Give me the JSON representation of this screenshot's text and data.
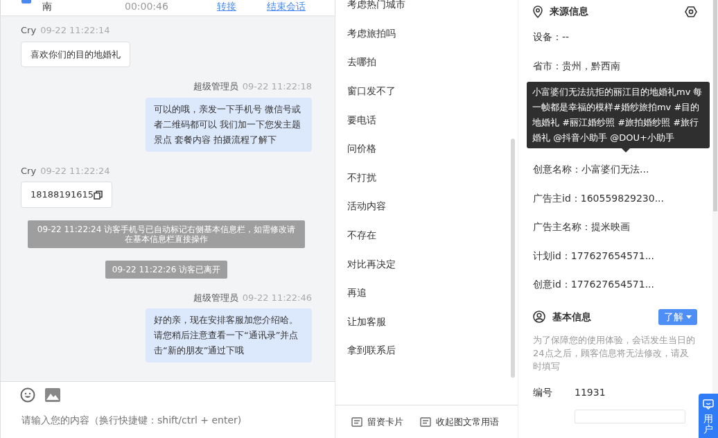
{
  "header": {
    "location": "南",
    "duration": "00:00:46",
    "actions": [
      "转接",
      "结束会话"
    ]
  },
  "messages": [
    {
      "kind": "visitor",
      "sender": "Cry",
      "time": "09-22 11:22:14",
      "text": "喜欢你们的目的地婚礼"
    },
    {
      "kind": "agent",
      "sender": "超级管理员",
      "time": "09-22 11:22:18",
      "text": "可以的哦，亲发一下手机号 微信号或者二维码都可以 我们加一下您发主题景点 套餐内容 拍摄流程了解下"
    },
    {
      "kind": "visitor",
      "sender": "Cry",
      "time": "09-22 11:22:24",
      "text": "18188191615",
      "copyable": true
    },
    {
      "kind": "system",
      "text": "09-22 11:22:24 访客手机号已自动标记右侧基本信息栏，如需修改请在基本信息栏直接操作"
    },
    {
      "kind": "system",
      "text": "09-22 11:22:26 访客已离开"
    },
    {
      "kind": "agent",
      "sender": "超级管理员",
      "time": "09-22 11:22:46",
      "text": "好的亲，现在安排客服加您介绍哈。请您稍后注意查看一下“通讯录”并点击“新的朋友”通过下哦"
    }
  ],
  "input": {
    "placeholder": "请输入您的内容（换行快捷键：shift/ctrl + enter)"
  },
  "quick_replies": [
    "考虑热门城市",
    "考虑旅拍吗",
    "去哪拍",
    "窗口发不了",
    "要电话",
    "问价格",
    "不打扰",
    "活动内容",
    "不存在",
    "对比再决定",
    "再追",
    "让加客服",
    "拿到联系后"
  ],
  "quick_reply_actions": [
    "留资卡片",
    "收起图文常用语"
  ],
  "source_info": {
    "title": "来源信息",
    "rows": [
      {
        "kind": "row",
        "text": "设备：--"
      },
      {
        "kind": "row",
        "text": "省市：贵州，黔西南"
      },
      {
        "kind": "tooltip",
        "text": "小富婆们无法抗拒的丽江目的地婚礼mv 每一帧都是幸福的模样#婚纱旅拍mv #目的地婚礼 #丽江婚纱照 #旅拍婚纱照 #旅行婚礼 @抖音小助手 @DOU+小助手"
      },
      {
        "kind": "row",
        "text": "创意名称：小富婆们无法..."
      },
      {
        "kind": "row",
        "text": "广告主id：160559829230..."
      },
      {
        "kind": "row",
        "text": "广告主名称：提米映画"
      },
      {
        "kind": "row",
        "text": "计划id：177627654571..."
      },
      {
        "kind": "row",
        "text": "创意id：177627654571..."
      }
    ]
  },
  "basic_info": {
    "title": "基本信息",
    "button": "了解",
    "notice": "为了保障您的使用体验，会话发生当日的24点之后，顾客信息将无法修改，请及时填写",
    "fields": [
      {
        "label": "编号",
        "value": "11931"
      }
    ]
  },
  "float_tab": "用户"
}
